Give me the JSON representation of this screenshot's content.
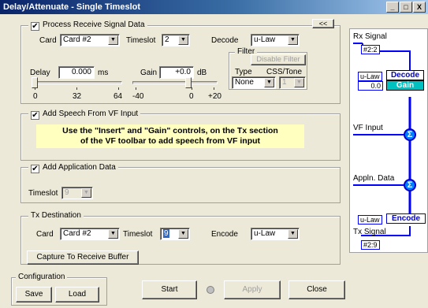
{
  "window": {
    "title": "Delay/Attenuate - Single Timeslot",
    "min_label": "_",
    "max_label": "□",
    "close_label": "X",
    "collapse_label": "<<"
  },
  "receive": {
    "checkbox_label": "Process Receive Signal Data",
    "checked": true,
    "card_label": "Card",
    "card_value": "Card #2",
    "timeslot_label": "Timeslot",
    "timeslot_value": "2",
    "decode_label": "Decode",
    "decode_value": "u-Law",
    "delay_label": "Delay",
    "delay_value": "0.000",
    "delay_unit": "ms",
    "gain_label": "Gain",
    "gain_value": "+0.0",
    "gain_unit": "dB",
    "delay_ticks": [
      "0",
      "32",
      "64"
    ],
    "gain_ticks": [
      "-40",
      "0",
      "+20"
    ],
    "delay_level": 0.0,
    "gain_level": 0.667,
    "filter": {
      "legend": "Filter",
      "disable_label": "Disable Filter",
      "type_label": "Type",
      "type_value": "None",
      "css_label": "CSS/Tone",
      "css_value": "1"
    }
  },
  "speech": {
    "checkbox_label": "Add Speech From VF Input",
    "checked": true,
    "message_line1": "Use the \"Insert\" and \"Gain\" controls, on the Tx section",
    "message_line2": "of the VF toolbar to add speech from VF input"
  },
  "application": {
    "checkbox_label": "Add Application Data",
    "checked": true,
    "timeslot_label": "Timeslot",
    "timeslot_value": "9"
  },
  "tx": {
    "legend": "Tx Destination",
    "card_label": "Card",
    "card_value": "Card #2",
    "timeslot_label": "Timeslot",
    "timeslot_value": "9",
    "encode_label": "Encode",
    "encode_value": "u-Law",
    "capture_label": "Capture To Receive Buffer"
  },
  "configuration": {
    "legend": "Configuration",
    "save_label": "Save",
    "load_label": "Load"
  },
  "footer": {
    "start_label": "Start",
    "apply_label": "Apply",
    "close_label": "Close"
  },
  "diagram": {
    "rx_signal_label": "Rx Signal",
    "rx_signal_value": "#2:2",
    "decode_law": "u-Law",
    "decode_block": "Decode",
    "gain_value": "0.0",
    "gain_block": "Gain",
    "vf_input_label": "VF Input",
    "appln_data_label": "Appln. Data",
    "sum_symbol": "Σ",
    "encode_law": "u-Law",
    "encode_block": "Encode",
    "tx_signal_label": "Tx Signal",
    "tx_signal_value": "#2:9"
  },
  "colors": {
    "flow_line": "#0000ff",
    "gain_block": "#00c0c0",
    "message_bg": "#ffffc0",
    "title_bar": "#0a246a"
  }
}
